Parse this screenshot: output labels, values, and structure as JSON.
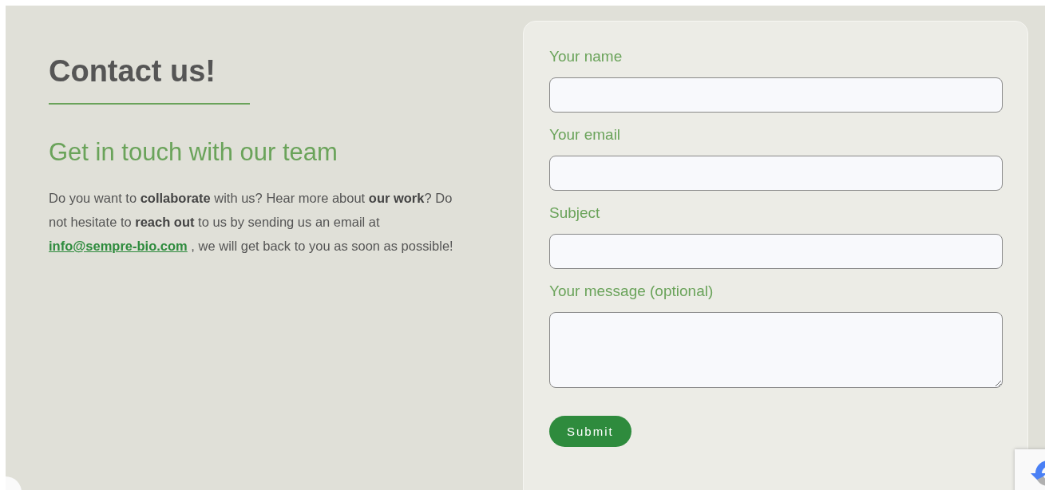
{
  "heading": "Contact us!",
  "subheading": "Get in touch with our team",
  "intro": {
    "before": "Do you want to **collaborate** with us? Hear more about **our work**? Do not hesitate to **reach out** to us by sending us an email at ",
    "link": "info@sempre-bio.com",
    "after": " , we will get back to you as soon as possible!"
  },
  "form": {
    "fields": [
      {
        "label": "Your name",
        "kind": "input"
      },
      {
        "label": "Your email",
        "kind": "input"
      },
      {
        "label": "Subject",
        "kind": "input"
      },
      {
        "label": "Your message (optional)",
        "kind": "textarea"
      }
    ],
    "submit": "Submit"
  }
}
